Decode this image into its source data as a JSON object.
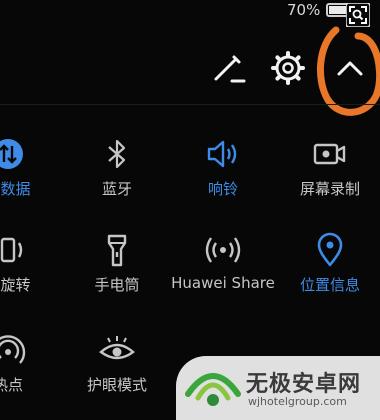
{
  "status_bar": {
    "battery_percent": "70%",
    "battery_level": 0.7,
    "icons": [
      "battery-icon",
      "screenshot-icon"
    ]
  },
  "toolbar": {
    "edit_icon": "pencil-icon",
    "settings_icon": "gear-icon",
    "collapse_icon": "chevron-up-icon",
    "highlight_color": "#e8772a"
  },
  "colors": {
    "background": "#070707",
    "active": "#3f8be8",
    "inactive": "#c6c6c6"
  },
  "tiles": [
    {
      "label": "动数据",
      "icon": "mobile-data-icon",
      "active": true
    },
    {
      "label": "蓝牙",
      "icon": "bluetooth-icon",
      "active": false
    },
    {
      "label": "响铃",
      "icon": "speaker-icon",
      "active": true
    },
    {
      "label": "屏幕录制",
      "icon": "screen-record-icon",
      "active": false
    },
    {
      "label": "动旋转",
      "icon": "auto-rotate-icon",
      "active": false
    },
    {
      "label": "手电筒",
      "icon": "flashlight-icon",
      "active": false
    },
    {
      "label": "Huawei Share",
      "icon": "huawei-share-icon",
      "active": false
    },
    {
      "label": "位置信息",
      "icon": "location-icon",
      "active": true
    },
    {
      "label": "热点",
      "icon": "hotspot-icon",
      "active": false
    },
    {
      "label": "护眼模式",
      "icon": "eye-comfort-icon",
      "active": false
    }
  ],
  "watermark": {
    "title": "无极安卓网",
    "url": "wjhotelgroup.com"
  }
}
